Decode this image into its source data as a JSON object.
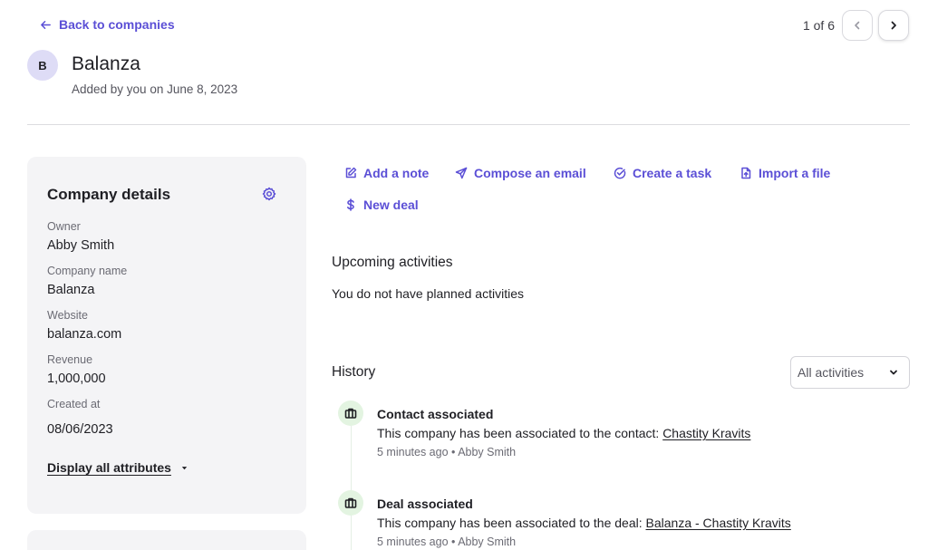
{
  "header": {
    "back_label": "Back to companies",
    "pager_text": "1 of 6"
  },
  "company": {
    "avatar_letter": "B",
    "name": "Balanza",
    "added_by": "Added by you on June 8, 2023"
  },
  "details": {
    "title": "Company details",
    "attributes": [
      {
        "label": "Owner",
        "value": "Abby Smith"
      },
      {
        "label": "Company name",
        "value": "Balanza"
      },
      {
        "label": "Website",
        "value": "balanza.com"
      },
      {
        "label": "Revenue",
        "value": "1,000,000"
      },
      {
        "label": "Created at",
        "value": "08/06/2023"
      }
    ],
    "display_all_label": "Display all attributes"
  },
  "actions": {
    "add_note": "Add a note",
    "compose_email": "Compose an email",
    "create_task": "Create a task",
    "import_file": "Import a file",
    "new_deal": "New deal"
  },
  "upcoming": {
    "title": "Upcoming activities",
    "empty_text": "You do not have planned activities"
  },
  "history": {
    "title": "History",
    "filter_value": "All activities",
    "items": [
      {
        "title": "Contact associated",
        "text": "This company has been associated to the contact: ",
        "link": "Chastity Kravits",
        "time": "5 minutes ago",
        "author": "Abby Smith",
        "icon": "briefcase-icon"
      },
      {
        "title": "Deal associated",
        "text": "This company has been associated to the deal: ",
        "link": "Balanza - Chastity Kravits",
        "time": "5 minutes ago",
        "author": "Abby Smith",
        "icon": "briefcase-icon"
      }
    ]
  },
  "colors": {
    "accent": "#5b4fd6",
    "card_bg": "#f4f4f6",
    "avatar_bg": "#dedcf6",
    "timeline_icon_bg": "#e3f4e1"
  }
}
